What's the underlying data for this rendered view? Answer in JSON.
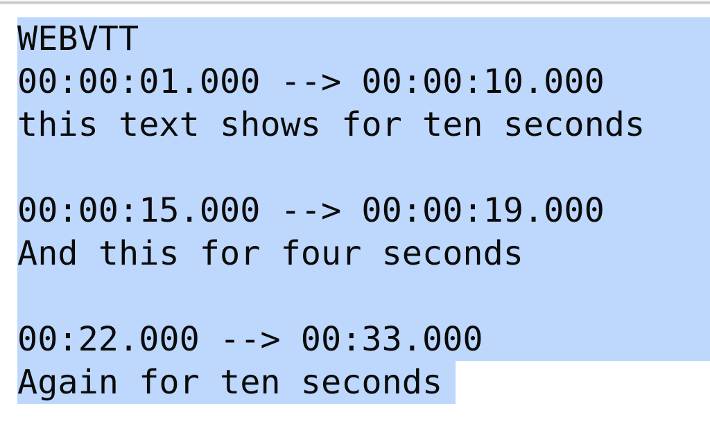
{
  "document": {
    "kind": "webvtt-subtitle-file",
    "signature": "WEBVTT",
    "lines": [
      {
        "text": "WEBVTT",
        "selection": "full"
      },
      {
        "text": "00:00:01.000 --> 00:00:10.000",
        "selection": "full"
      },
      {
        "text": "this text shows for ten seconds",
        "selection": "full"
      },
      {
        "text": "",
        "selection": "full"
      },
      {
        "text": "00:00:15.000 --> 00:00:19.000",
        "selection": "full"
      },
      {
        "text": "And this for four seconds",
        "selection": "full"
      },
      {
        "text": "",
        "selection": "full"
      },
      {
        "text": "00:22.000 --> 00:33.000",
        "selection": "full"
      },
      {
        "text": "Again for ten seconds",
        "selection": "partial"
      }
    ],
    "cues": [
      {
        "start": "00:00:01.000",
        "arrow": "-->",
        "end": "00:00:10.000",
        "caption": "this text shows for ten seconds"
      },
      {
        "start": "00:00:15.000",
        "arrow": "-->",
        "end": "00:00:19.000",
        "caption": "And this for four seconds"
      },
      {
        "start": "00:22.000",
        "arrow": "-->",
        "end": "00:33.000",
        "caption": "Again for ten seconds"
      }
    ]
  },
  "colors": {
    "selection_highlight": "#bdd7fd",
    "page_background": "#ffffff",
    "text": "#0b0b0b",
    "chrome_edge": "#b9b9b9"
  }
}
